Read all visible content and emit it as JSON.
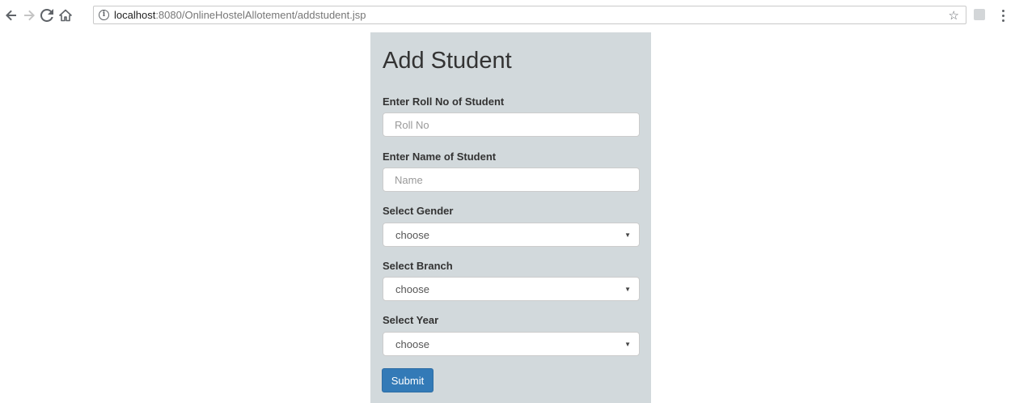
{
  "browser": {
    "url_host": "localhost",
    "url_rest": ":8080/OnlineHostelAllotement/addstudent.jsp",
    "info_glyph": "i",
    "star_glyph": "☆",
    "icons": [
      "back-arrow-icon",
      "forward-arrow-icon",
      "reload-icon",
      "home-icon",
      "info-icon",
      "star-icon",
      "extension-icon",
      "menu-dots-icon"
    ]
  },
  "form": {
    "title": "Add Student",
    "roll_label": "Enter Roll No of Student",
    "roll_placeholder": "Roll No",
    "name_label": "Enter Name of Student",
    "name_placeholder": "Name",
    "gender_label": "Select Gender",
    "gender_value": "choose",
    "branch_label": "Select Branch",
    "branch_value": "choose",
    "year_label": "Select Year",
    "year_value": "choose",
    "caret": "▼",
    "submit_label": "Submit"
  },
  "colors": {
    "panel_bg": "#d2d9dc",
    "submit_bg": "#337ab7"
  }
}
